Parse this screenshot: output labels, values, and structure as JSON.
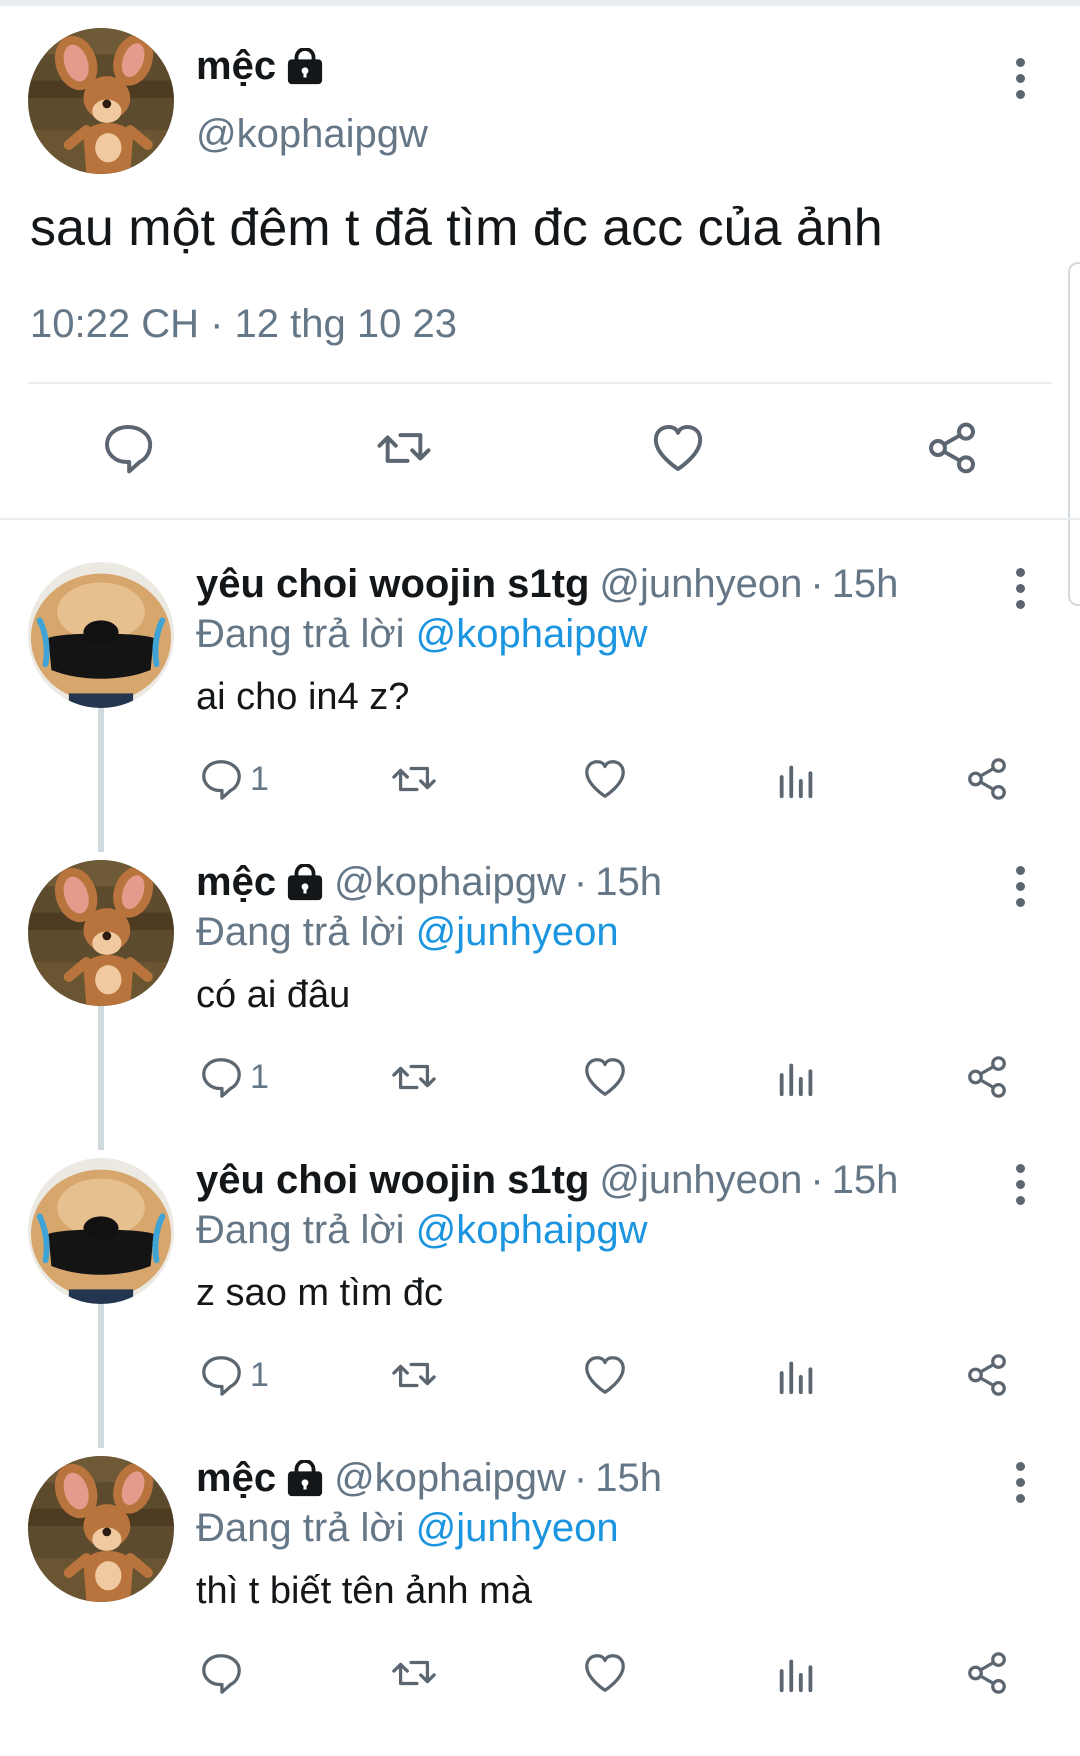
{
  "main_tweet": {
    "name": "mệc",
    "handle": "@kophaipgw",
    "text": "sau một đêm t đã tìm đc acc của ảnh",
    "timestamp": "10:22 CH · 12 thg 10 23",
    "actions": [
      "reply-icon",
      "retweet-icon",
      "like-icon",
      "share-icon"
    ]
  },
  "replies": [
    {
      "name": "yêu choi woojin s1tg",
      "handle": "@junhyeon",
      "time": "15h",
      "replying_prefix": "Đang trả lời",
      "replying_to": "@kophaipgw",
      "text": "ai cho in4 z?",
      "reply_count": "1",
      "avatar": "dog-avatar"
    },
    {
      "name": "mệc",
      "handle": "@kophaipgw",
      "time": "15h",
      "replying_prefix": "Đang trả lời",
      "replying_to": "@junhyeon",
      "text": "có ai đâu",
      "reply_count": "1",
      "avatar": "mouse-avatar"
    },
    {
      "name": "yêu choi woojin s1tg",
      "handle": "@junhyeon",
      "time": "15h",
      "replying_prefix": "Đang trả lời",
      "replying_to": "@kophaipgw",
      "text": "z sao m tìm đc",
      "reply_count": "1",
      "avatar": "dog-avatar"
    },
    {
      "name": "mệc",
      "handle": "@kophaipgw",
      "time": "15h",
      "replying_prefix": "Đang trả lời",
      "replying_to": "@junhyeon",
      "text": "thì t biết tên ảnh mà",
      "reply_count": "",
      "avatar": "mouse-avatar"
    }
  ],
  "colors": {
    "mention": "#1b95e0",
    "muted": "#657786",
    "icon": "#5b6670"
  }
}
